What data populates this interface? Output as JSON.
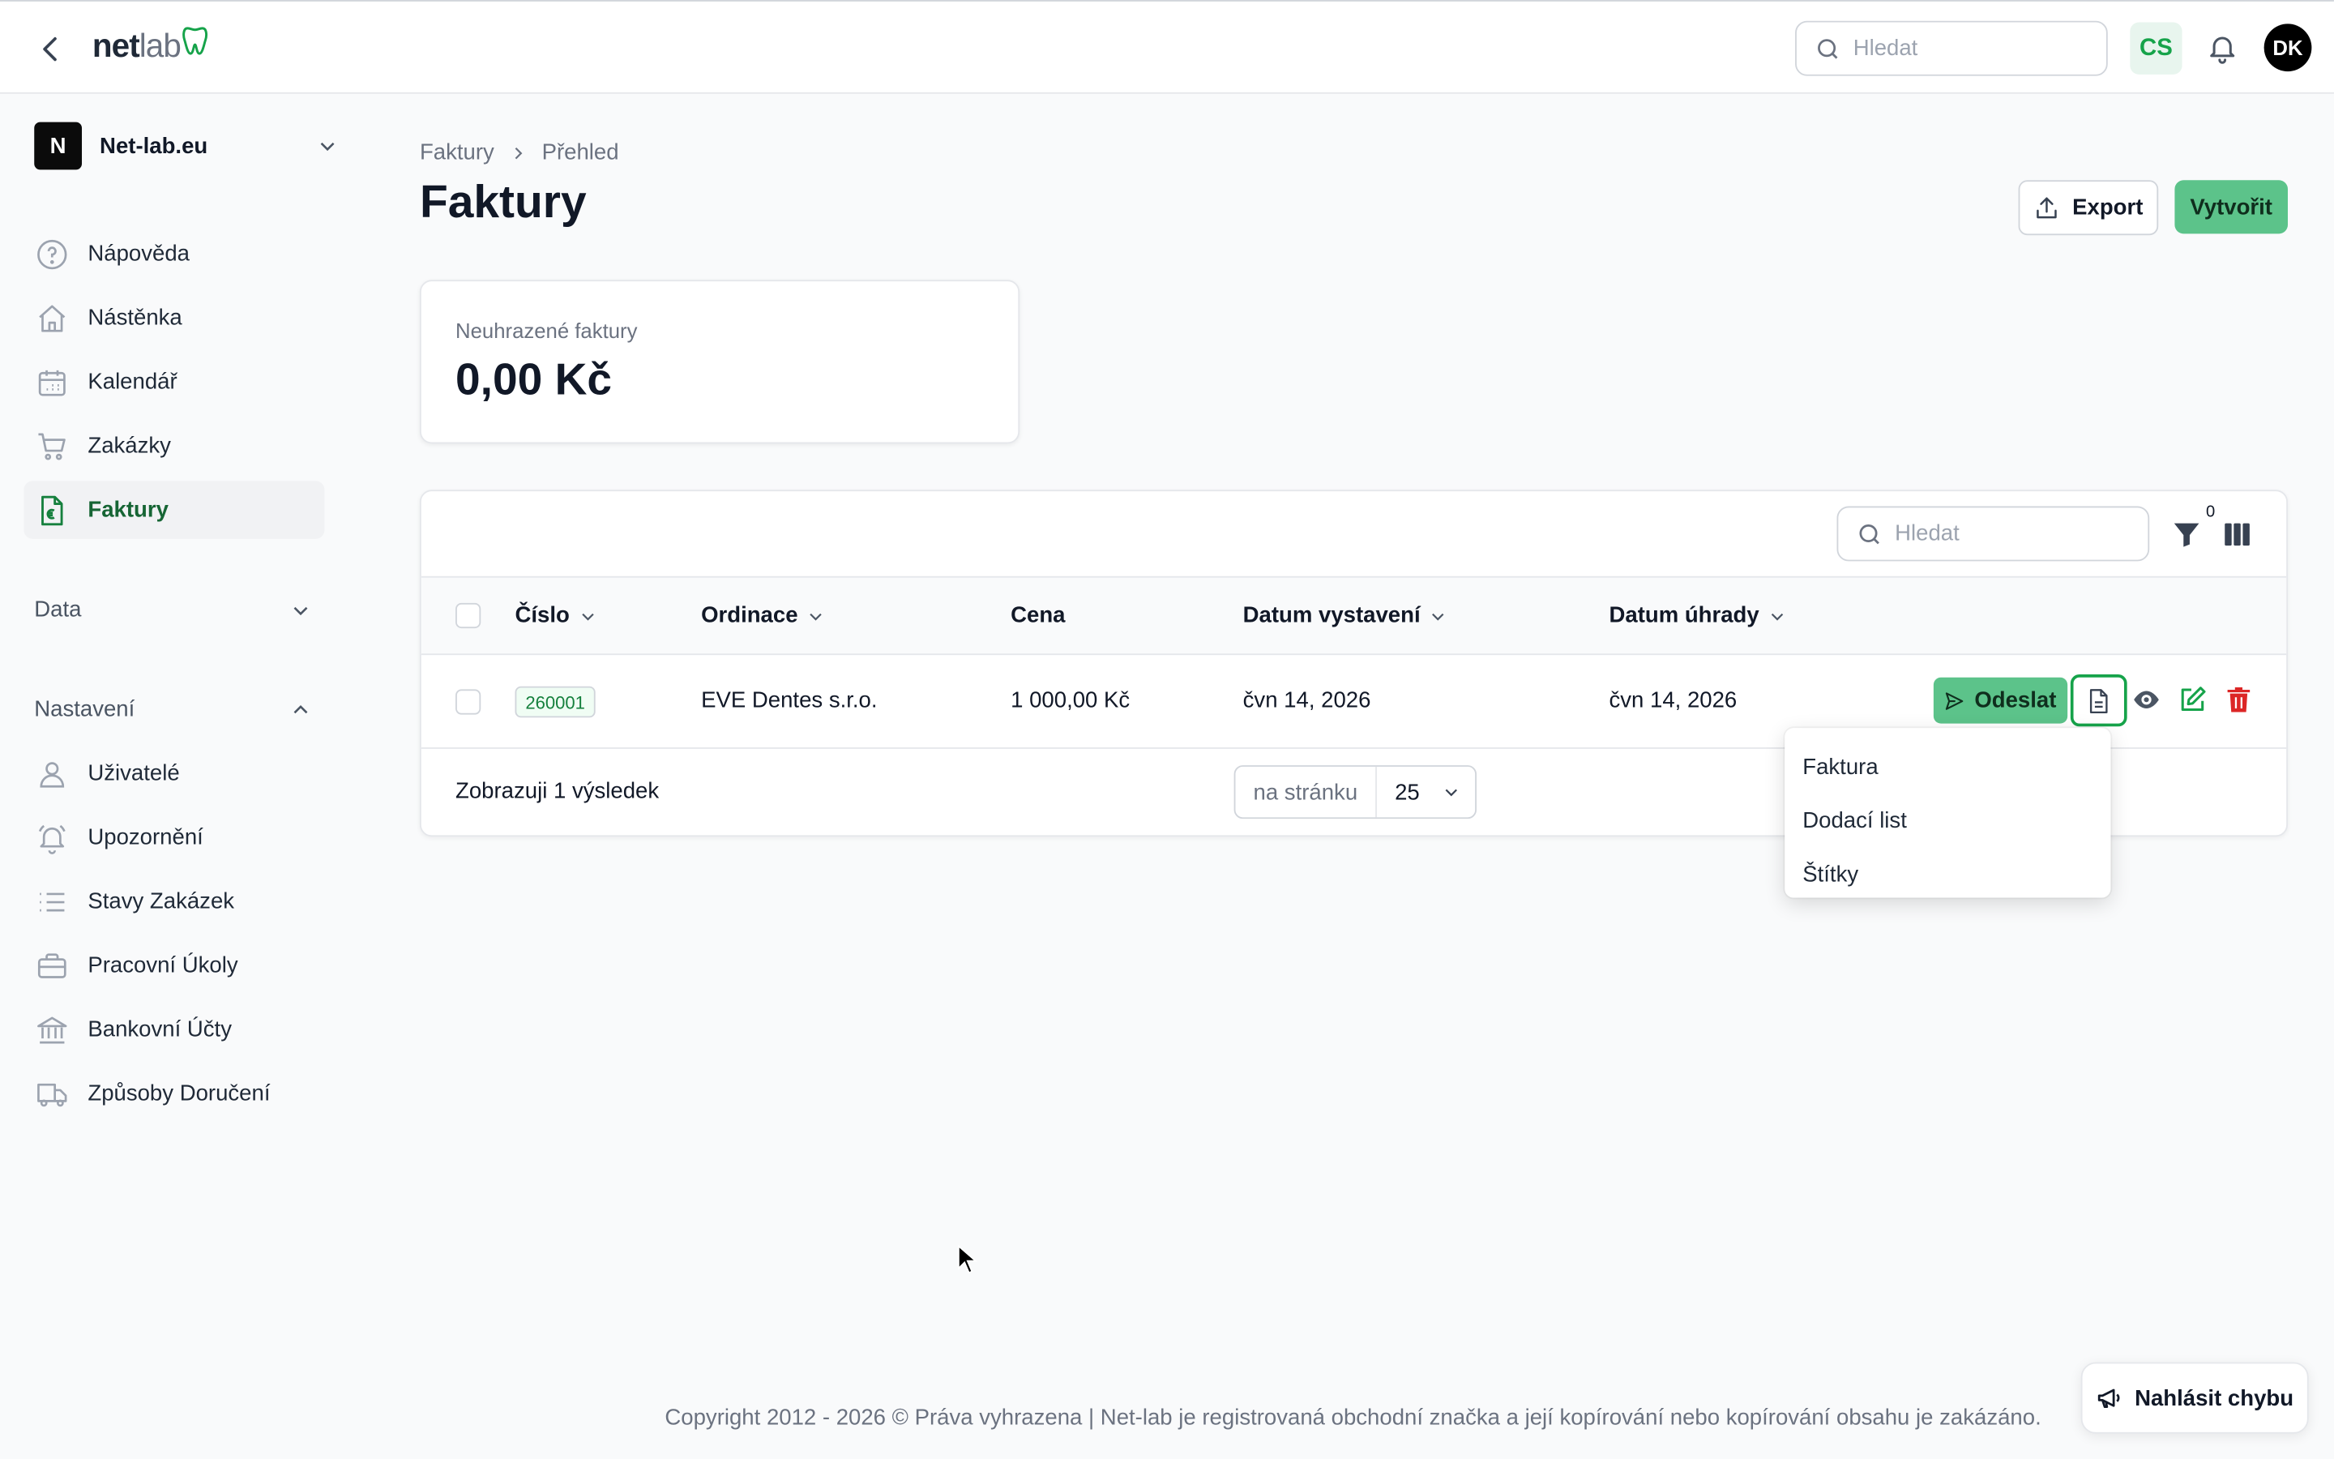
{
  "header": {
    "logo_net": "net",
    "logo_lab": "lab",
    "search_placeholder": "Hledat",
    "language": "CS",
    "user_initials": "DK"
  },
  "sidebar": {
    "org_initial": "N",
    "org_name": "Net-lab.eu",
    "items": [
      {
        "label": "Nápověda",
        "icon": "help-icon"
      },
      {
        "label": "Nástěnka",
        "icon": "home-icon"
      },
      {
        "label": "Kalendář",
        "icon": "calendar-icon"
      },
      {
        "label": "Zakázky",
        "icon": "cart-icon"
      },
      {
        "label": "Faktury",
        "icon": "invoice-icon",
        "active": true
      }
    ],
    "data_section": "Data",
    "settings_section": "Nastavení",
    "settings_items": [
      {
        "label": "Uživatelé",
        "icon": "user-icon"
      },
      {
        "label": "Upozornění",
        "icon": "bell-icon"
      },
      {
        "label": "Stavy Zakázek",
        "icon": "list-icon"
      },
      {
        "label": "Pracovní Úkoly",
        "icon": "briefcase-icon"
      },
      {
        "label": "Bankovní Účty",
        "icon": "bank-icon"
      },
      {
        "label": "Způsoby Doručení",
        "icon": "truck-icon"
      }
    ]
  },
  "main": {
    "breadcrumb": [
      "Faktury",
      "Přehled"
    ],
    "title": "Faktury",
    "export_label": "Export",
    "create_label": "Vytvořit",
    "stat": {
      "label": "Neuhrazené faktury",
      "value": "0,00 Kč"
    },
    "table": {
      "search_placeholder": "Hledat",
      "filter_count": "0",
      "columns": [
        "Číslo",
        "Ordinace",
        "Cena",
        "Datum vystavení",
        "Datum úhrady"
      ],
      "rows": [
        {
          "number": "260001",
          "practice": "EVE Dentes s.r.o.",
          "price": "1 000,00 Kč",
          "issued": "čvn 14, 2026",
          "due": "čvn 14, 2026"
        }
      ],
      "send_label": "Odeslat",
      "summary": "Zobrazuji 1 výsledek",
      "per_page_label": "na stránku",
      "per_page_value": "25"
    },
    "document_menu": [
      "Faktura",
      "Dodací list",
      "Štítky"
    ]
  },
  "footer": {
    "copyright": "Copyright 2012 - 2026 © Práva vyhrazena | Net-lab je registrovaná obchodní značka a její kopírování nebo kopírování obsahu je zakázáno.",
    "report_label": "Nahlásit chybu"
  },
  "colors": {
    "accent": "#5cc38a",
    "accent_dark": "#16a34a",
    "danger": "#dc2626"
  }
}
